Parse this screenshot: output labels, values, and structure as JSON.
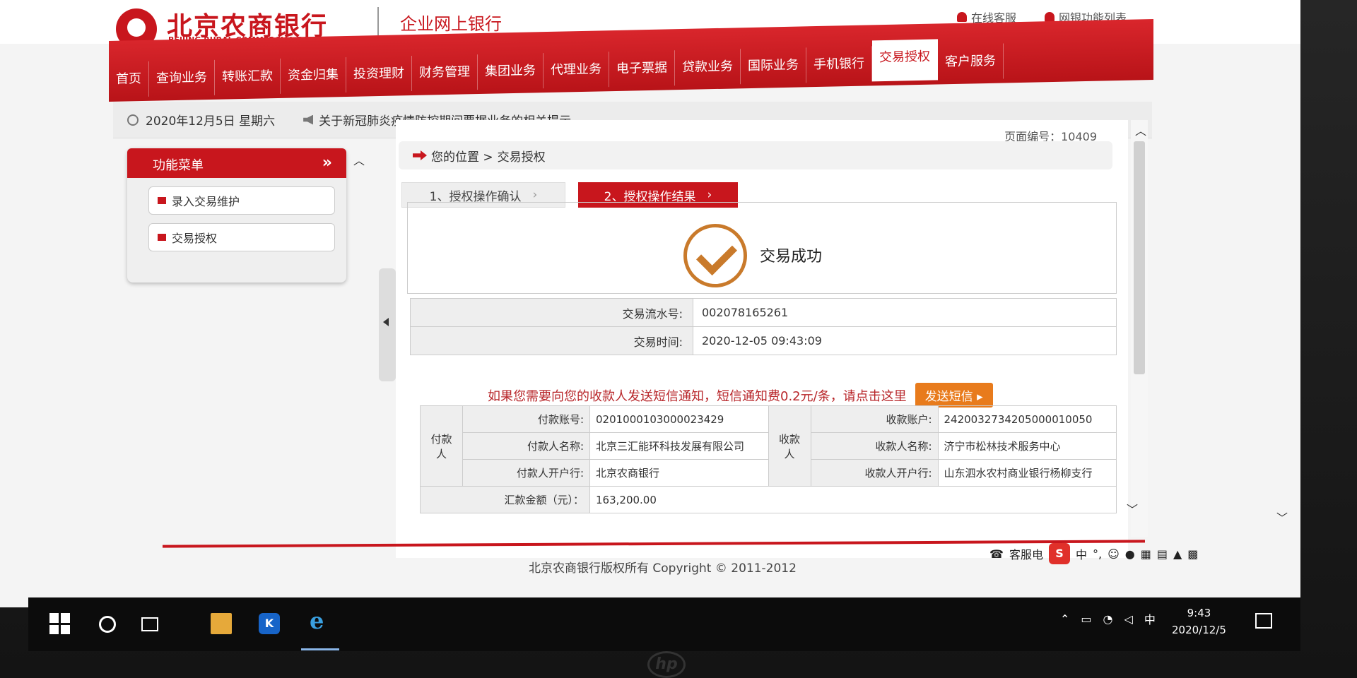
{
  "bank": {
    "name_cn": "北京农商银行",
    "name_en": "BEIJING RURAL COMMERCIAL BANK",
    "subtitle": "企业网上银行"
  },
  "toplinks": {
    "online_service": "在线客服",
    "function_list": "网银功能列表"
  },
  "nav": {
    "items": [
      "首页",
      "查询业务",
      "转账汇款",
      "资金归集",
      "投资理财",
      "财务管理",
      "集团业务",
      "代理业务",
      "电子票据",
      "贷款业务",
      "国际业务",
      "手机银行",
      "交易授权",
      "客户服务"
    ],
    "active": "交易授权"
  },
  "datebar": {
    "date": "2020年12月5日 星期六",
    "notice": "关于新冠肺炎疫情防控期间票据业务的相关提示"
  },
  "sidebar": {
    "title": "功能菜单",
    "items": [
      "录入交易维护",
      "交易授权"
    ]
  },
  "page": {
    "page_no": "页面编号：10409",
    "breadcrumb_prefix": "您的位置 >",
    "breadcrumb_current": "交易授权"
  },
  "steps": {
    "step1": "1、授权操作确认",
    "step2": "2、授权操作结果"
  },
  "result": {
    "message": "交易成功"
  },
  "transaction": {
    "serial_label": "交易流水号:",
    "serial_value": "002078165261",
    "time_label": "交易时间:",
    "time_value": "2020-12-05 09:43:09"
  },
  "sms": {
    "text": "如果您需要向您的收款人发送短信通知，短信通知费0.2元/条，请点击这里",
    "button": "发送短信"
  },
  "payer": {
    "group_label": "付款人",
    "account_label": "付款账号:",
    "account_value": "0201000103000023429",
    "name_label": "付款人名称:",
    "name_value": "北京三汇能环科技发展有限公司",
    "bank_label": "付款人开户行:",
    "bank_value": "北京农商银行"
  },
  "payee": {
    "group_label": "收款人",
    "account_label": "收款账户:",
    "account_value": "242003273420500001005​0",
    "name_label": "收款人名称:",
    "name_value": "济宁市松林技术服务中心",
    "bank_label": "收款人开户行:",
    "bank_value": "山东泗水农村商业银行杨柳支行"
  },
  "amount": {
    "label": "汇款金额（元）：",
    "value": "163,200.00"
  },
  "footer": {
    "copyright": "北京农商银行版权所有 Copyright © 2011-2012"
  },
  "ime": {
    "service_label": "客服电",
    "logo": "S",
    "mode": "中"
  },
  "taskbar": {
    "kapp_label": "K",
    "ie_label": "e",
    "tray_lang": "中",
    "time": "9:43",
    "date": "2020/12/5"
  },
  "monitor": {
    "brand": "hp"
  },
  "colors": {
    "brand_red": "#c8161d",
    "success_orange": "#c97a2b",
    "sms_button": "#e87b1c"
  }
}
